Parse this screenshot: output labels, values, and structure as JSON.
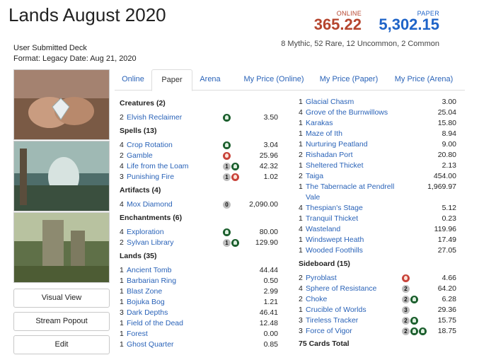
{
  "title": "Lands August 2020",
  "prices": {
    "online_label": "ONLINE",
    "online": "365.22",
    "paper_label": "PAPER",
    "paper": "5,302.15"
  },
  "rarity_summary": "8 Mythic, 52 Rare, 12 Uncommon, 2 Common",
  "meta": {
    "source": "User Submitted Deck",
    "format_date": "Format: Legacy Date: Aug 21, 2020"
  },
  "buttons": {
    "visual": "Visual View",
    "stream": "Stream Popout",
    "edit": "Edit"
  },
  "tabs": [
    "Online",
    "Paper",
    "Arena",
    "My Price (Online)",
    "My Price (Paper)",
    "My Price (Arena)"
  ],
  "active_tab": "Paper",
  "left_column": [
    {
      "section": "Creatures (2)"
    },
    {
      "qty": "2",
      "name": "Elvish Reclaimer",
      "mana": [
        "G"
      ],
      "price": "3.50"
    },
    {
      "section": "Spells (13)"
    },
    {
      "qty": "4",
      "name": "Crop Rotation",
      "mana": [
        "G"
      ],
      "price": "3.04"
    },
    {
      "qty": "2",
      "name": "Gamble",
      "mana": [
        "R"
      ],
      "price": "25.96"
    },
    {
      "qty": "4",
      "name": "Life from the Loam",
      "mana": [
        "1",
        "G"
      ],
      "price": "42.32"
    },
    {
      "qty": "3",
      "name": "Punishing Fire",
      "mana": [
        "1",
        "R"
      ],
      "price": "1.02"
    },
    {
      "section": "Artifacts (4)"
    },
    {
      "qty": "4",
      "name": "Mox Diamond",
      "mana": [
        "0"
      ],
      "price": "2,090.00"
    },
    {
      "section": "Enchantments (6)"
    },
    {
      "qty": "4",
      "name": "Exploration",
      "mana": [
        "G"
      ],
      "price": "80.00"
    },
    {
      "qty": "2",
      "name": "Sylvan Library",
      "mana": [
        "1",
        "G"
      ],
      "price": "129.90"
    },
    {
      "section": "Lands (35)"
    },
    {
      "qty": "1",
      "name": "Ancient Tomb",
      "price": "44.44"
    },
    {
      "qty": "1",
      "name": "Barbarian Ring",
      "price": "0.50"
    },
    {
      "qty": "1",
      "name": "Blast Zone",
      "price": "2.99"
    },
    {
      "qty": "1",
      "name": "Bojuka Bog",
      "price": "1.21"
    },
    {
      "qty": "3",
      "name": "Dark Depths",
      "price": "46.41"
    },
    {
      "qty": "1",
      "name": "Field of the Dead",
      "price": "12.48"
    },
    {
      "qty": "1",
      "name": "Forest",
      "price": "0.00"
    },
    {
      "qty": "1",
      "name": "Ghost Quarter",
      "price": "0.85"
    }
  ],
  "right_column": [
    {
      "qty": "1",
      "name": "Glacial Chasm",
      "price": "3.00"
    },
    {
      "qty": "4",
      "name": "Grove of the Burnwillows",
      "price": "25.04"
    },
    {
      "qty": "1",
      "name": "Karakas",
      "price": "15.80"
    },
    {
      "qty": "1",
      "name": "Maze of Ith",
      "price": "8.94"
    },
    {
      "qty": "1",
      "name": "Nurturing Peatland",
      "price": "9.00"
    },
    {
      "qty": "2",
      "name": "Rishadan Port",
      "price": "20.80"
    },
    {
      "qty": "1",
      "name": "Sheltered Thicket",
      "price": "2.13"
    },
    {
      "qty": "2",
      "name": "Taiga",
      "price": "454.00"
    },
    {
      "qty": "1",
      "name": "The Tabernacle at Pendrell",
      "name2": "Vale",
      "price": "1,969.97"
    },
    {
      "qty": "4",
      "name": "Thespian's Stage",
      "price": "5.12"
    },
    {
      "qty": "1",
      "name": "Tranquil Thicket",
      "price": "0.23"
    },
    {
      "qty": "4",
      "name": "Wasteland",
      "price": "119.96"
    },
    {
      "qty": "1",
      "name": "Windswept Heath",
      "price": "17.49"
    },
    {
      "qty": "1",
      "name": "Wooded Foothills",
      "price": "27.05"
    },
    {
      "section": "Sideboard (15)"
    },
    {
      "qty": "2",
      "name": "Pyroblast",
      "mana": [
        "R"
      ],
      "price": "4.66"
    },
    {
      "qty": "4",
      "name": "Sphere of Resistance",
      "mana": [
        "2"
      ],
      "price": "64.20"
    },
    {
      "qty": "2",
      "name": "Choke",
      "mana": [
        "2",
        "G"
      ],
      "price": "6.28"
    },
    {
      "qty": "1",
      "name": "Crucible of Worlds",
      "mana": [
        "3"
      ],
      "price": "29.36"
    },
    {
      "qty": "3",
      "name": "Tireless Tracker",
      "mana": [
        "2",
        "G"
      ],
      "price": "15.75"
    },
    {
      "qty": "3",
      "name": "Force of Vigor",
      "mana": [
        "2",
        "G",
        "G"
      ],
      "price": "18.75"
    },
    {
      "total": "75 Cards Total"
    }
  ],
  "colors": {
    "online": "#b5452e",
    "paper": "#1f64c8",
    "link": "#2a63b8"
  }
}
